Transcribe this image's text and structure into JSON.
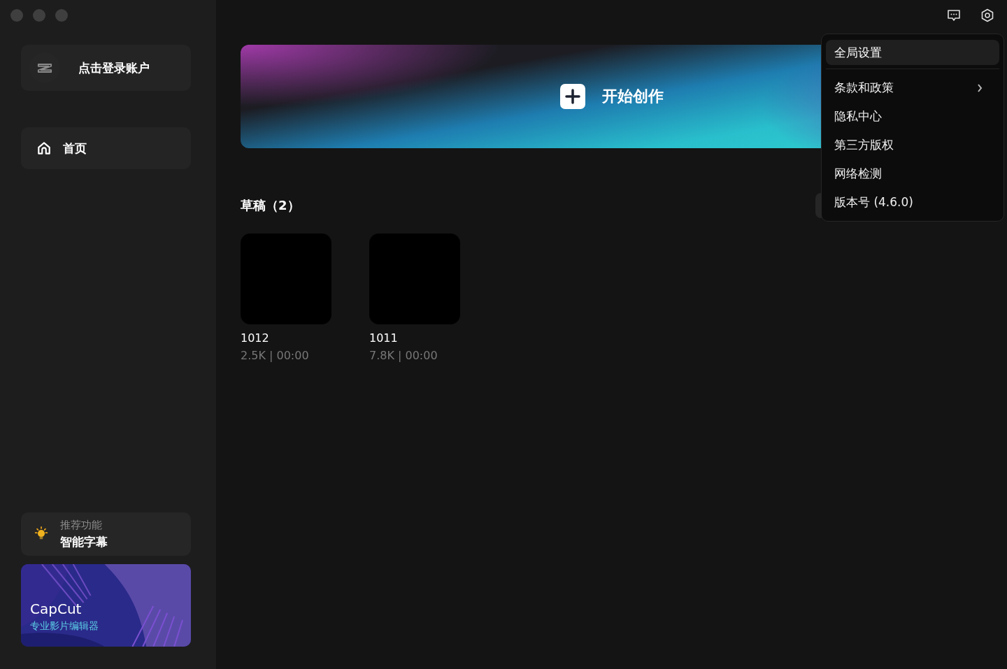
{
  "sidebar": {
    "account": {
      "label": "点击登录账户"
    },
    "nav": [
      {
        "label": "首页",
        "selected": true
      }
    ],
    "promo": {
      "caption": "推荐功能",
      "title": "智能字幕"
    },
    "ad": {
      "title": "CapCut",
      "subtitle": "专业影片编辑器"
    }
  },
  "main": {
    "create": {
      "label": "开始创作"
    },
    "drafts": {
      "heading": "草稿（2）",
      "items": [
        {
          "name": "1012",
          "meta": "2.5K | 00:00"
        },
        {
          "name": "1011",
          "meta": "7.8K | 00:00"
        }
      ]
    }
  },
  "settings_menu": {
    "items": [
      {
        "label": "全局设置",
        "selected": true,
        "submenu": false
      },
      {
        "label": "条款和政策",
        "selected": false,
        "submenu": true
      },
      {
        "label": "隐私中心",
        "selected": false,
        "submenu": false
      },
      {
        "label": "第三方版权",
        "selected": false,
        "submenu": false
      },
      {
        "label": "网络检测",
        "selected": false,
        "submenu": false
      },
      {
        "label": "版本号 (4.6.0)",
        "selected": false,
        "submenu": false
      }
    ]
  }
}
